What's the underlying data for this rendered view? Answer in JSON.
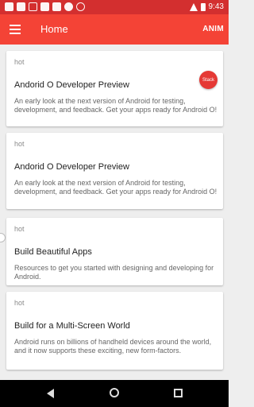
{
  "status_bar": {
    "time": "9:43",
    "left_icons": [
      "app-icon",
      "gallery-icon",
      "mail-icon",
      "android-icon",
      "play-icon",
      "alert-icon",
      "circle-icon"
    ]
  },
  "toolbar": {
    "title": "Home",
    "action_label": "ANIM",
    "color": "#f44336"
  },
  "fab": {
    "label": "Stack"
  },
  "cards": [
    {
      "tag": "hot",
      "title": "Andorid O Developer Preview",
      "body": "An early look at the next version of Android for testing, development, and feedback. Get your apps ready for Android O!"
    },
    {
      "tag": "hot",
      "title": "Andorid O Developer Preview",
      "body": "An early look at the next version of Android for testing, development, and feedback. Get your apps ready for Android O!"
    },
    {
      "tag": "hot",
      "title": "Build Beautiful Apps",
      "body": "Resources to get you started with designing and developing for Android."
    },
    {
      "tag": "hot",
      "title": "Build for a Multi-Screen World",
      "body": "Android runs on billions of handheld devices around the world, and it now supports these exciting, new form-factors."
    }
  ],
  "nav_bar": {
    "icons": [
      "back-icon",
      "home-icon",
      "recents-icon"
    ]
  }
}
